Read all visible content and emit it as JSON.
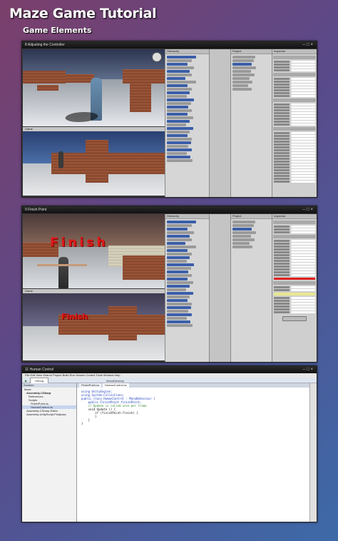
{
  "header": {
    "title": "Maze Game Tutorial",
    "subtitle": "Game Elements"
  },
  "panels": [
    {
      "window_title": "8 Adjusting the Controller",
      "scene_toolbar": "Gizmos",
      "game_toolbar": "Game"
    },
    {
      "window_title": "9 Finish Point",
      "scene_toolbar": "Gizmos",
      "game_toolbar": "Game",
      "finish_text_scene": "Finish",
      "finish_text_game": "Finish"
    },
    {
      "window_title": "11 Human Control",
      "editor_title": "MonoDevelop",
      "menu": "File  Edit  View  Search  Project  Build  Run  Version Control  Tools  Window  Help",
      "toolbar": "Debug",
      "solution_header": "Solution",
      "solution_items": [
        "Maze",
        "Assembly-CSharp",
        "References",
        "Scripts",
        "FinishPoint.cs",
        "HumanControl.cs",
        "Assembly-CSharp-Editor",
        "Assembly-UnityScript-Firstpass"
      ],
      "tabs": [
        "FinishPoint.cs",
        "HumanControl.cs"
      ],
      "code_lines": [
        "using UnityEngine;",
        "using System.Collections;",
        "",
        "public class HumanControl : MonoBehaviour {",
        "",
        "    public FinishPoint finishPoint;",
        "",
        "    // Update is called once per frame",
        "    void Update () {",
        "",
        "        if (finishPoint.finish) {",
        "",
        "        }",
        "    }",
        "}"
      ]
    }
  ],
  "icons": [
    "minimize-icon",
    "maximize-icon",
    "close-icon"
  ]
}
